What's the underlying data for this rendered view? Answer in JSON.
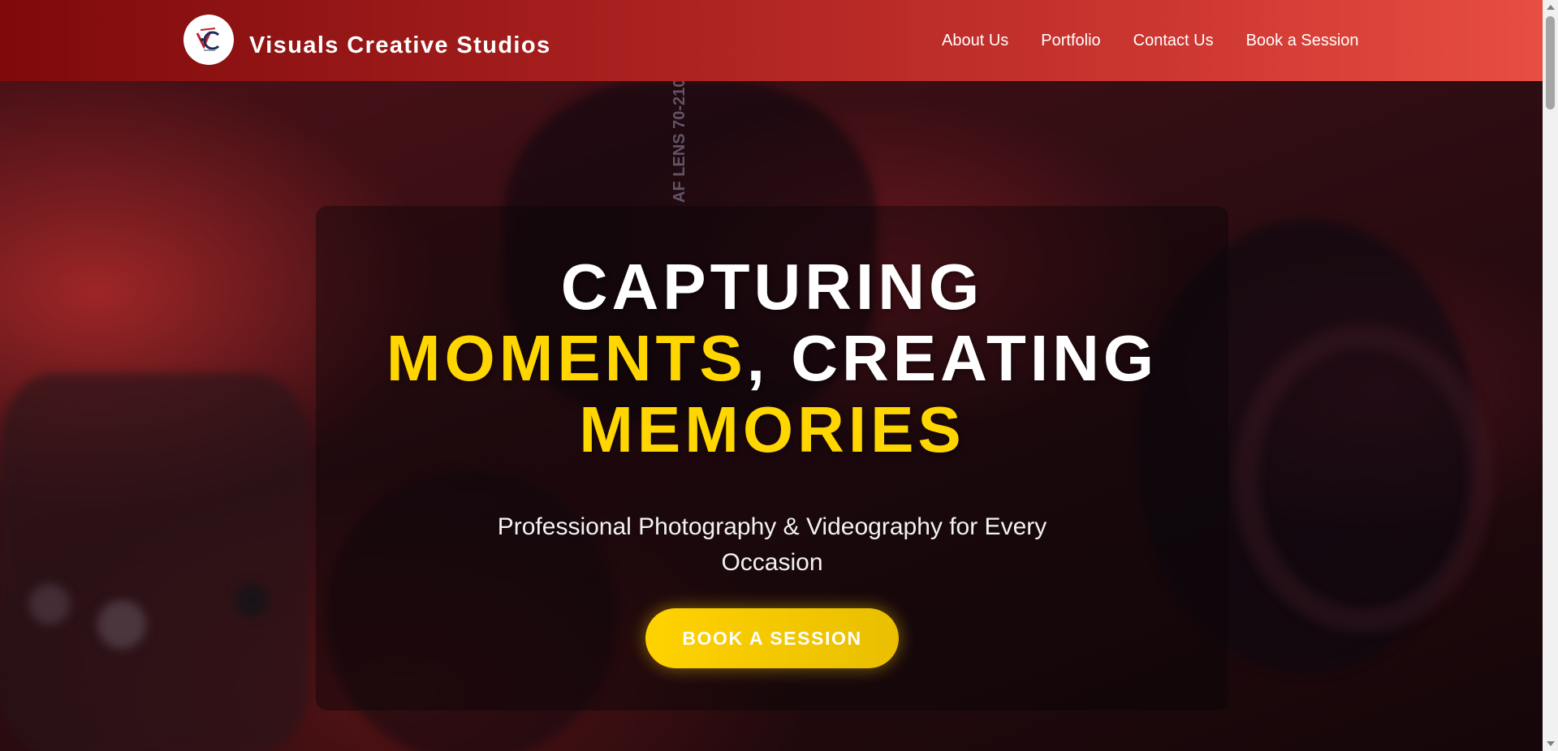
{
  "header": {
    "brand_name": "Visuals Creative Studios",
    "logo_icon": "vcs-logo-icon"
  },
  "nav": {
    "items": [
      {
        "label": "About Us"
      },
      {
        "label": "Portfolio"
      },
      {
        "label": "Contact Us"
      },
      {
        "label": "Book a Session"
      }
    ]
  },
  "hero": {
    "title_line1": "CAPTURING",
    "title_highlight1": "MOMENTS",
    "title_mid": ", CREATING",
    "title_highlight2": "MEMORIES",
    "subtitle": "Professional Photography & Videography for Every Occasion",
    "cta_label": "BOOK A SESSION",
    "background_lens_text": "AF LENS 70-210"
  },
  "colors": {
    "nav_gradient_start": "#7e0a0b",
    "nav_gradient_end": "#e84e42",
    "highlight": "#ffd600",
    "cta": "#ffd200"
  }
}
